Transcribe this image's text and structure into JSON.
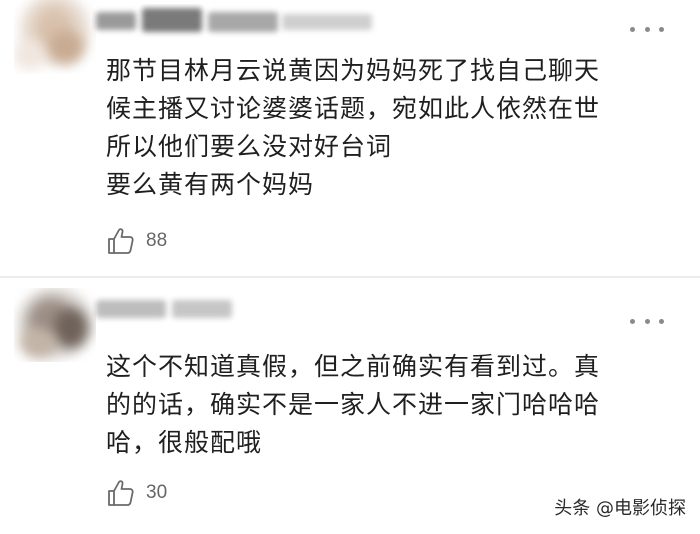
{
  "comments": [
    {
      "text_lines": [
        "那节目林月云说黄因为妈妈死了找自己聊天",
        "候主播又讨论婆婆话题，宛如此人依然在世",
        "所以他们要么没对好台词",
        "要么黄有两个妈妈"
      ],
      "likes": "88"
    },
    {
      "text_lines": [
        "这个不知道真假，但之前确实有看到过。真",
        "的的话，确实不是一家人不进一家门哈哈哈",
        "哈，很般配哦"
      ],
      "likes": "30"
    }
  ],
  "watermark": "头条 @电影侦探",
  "icons": {
    "like": "thumbs-up-icon",
    "more": "more-dots-icon"
  },
  "colors": {
    "text": "#1f1f1f",
    "meta": "#666666",
    "divider": "#ececec",
    "icon": "#8a8a8a"
  }
}
